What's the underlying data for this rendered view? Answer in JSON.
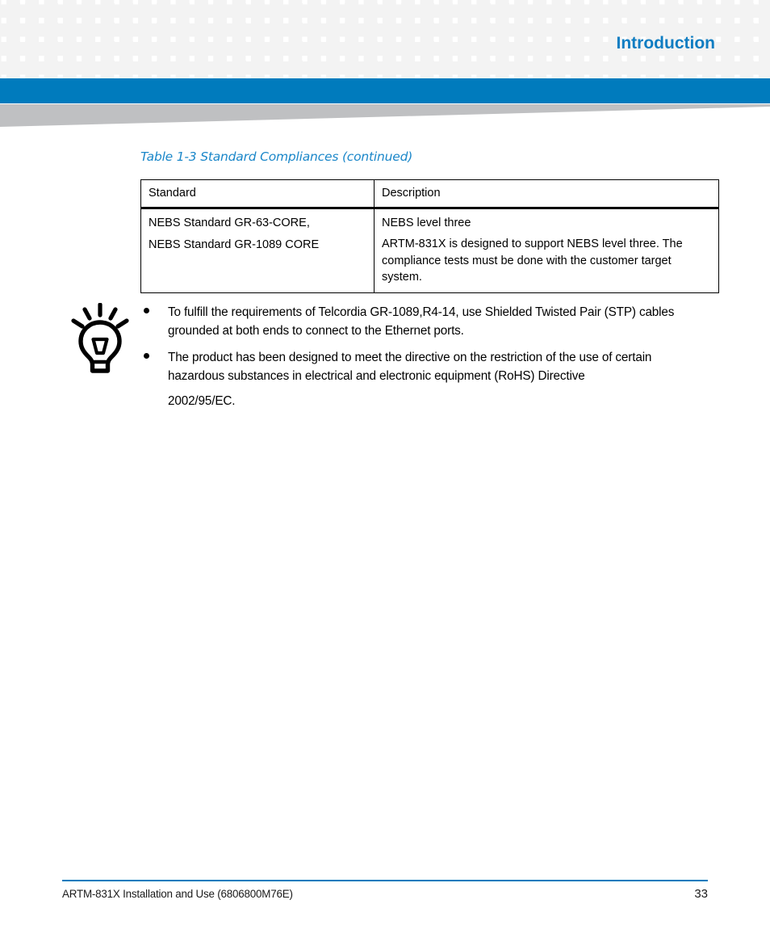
{
  "header": {
    "title": "Introduction",
    "accent_blue": "#007bbd",
    "title_blue": "#0f7dc2",
    "pattern_cell_color": "#f3f3f3",
    "wedge_gray": "#bfc0c2"
  },
  "table": {
    "caption": "Table 1-3 Standard Compliances (continued)",
    "caption_color": "#1b87c9",
    "columns": [
      "Standard",
      "Description"
    ],
    "rows": [
      {
        "standard_lines": [
          "NEBS Standard GR-63-CORE,",
          "NEBS Standard GR-1089 CORE"
        ],
        "description_lead": "NEBS level three",
        "description_body": "ARTM-831X is designed to support NEBS level three. The compliance tests must be done with the customer target system."
      }
    ]
  },
  "note": {
    "icon": "lightbulb-icon",
    "bullets": [
      {
        "text": "To fulfill the requirements of Telcordia GR-1089,R4-14, use Shielded Twisted Pair (STP) cables grounded at both ends to connect to the Ethernet ports.",
        "tail": ""
      },
      {
        "text": "The product has been designed to meet the directive on the restriction of the use of certain hazardous substances in electrical and electronic equipment (RoHS) Directive",
        "tail": "2002/95/EC."
      }
    ]
  },
  "footer": {
    "document_title": "ARTM-831X Installation and Use (6806800M76E)",
    "page_number": "33",
    "rule_color": "#007bbd"
  }
}
